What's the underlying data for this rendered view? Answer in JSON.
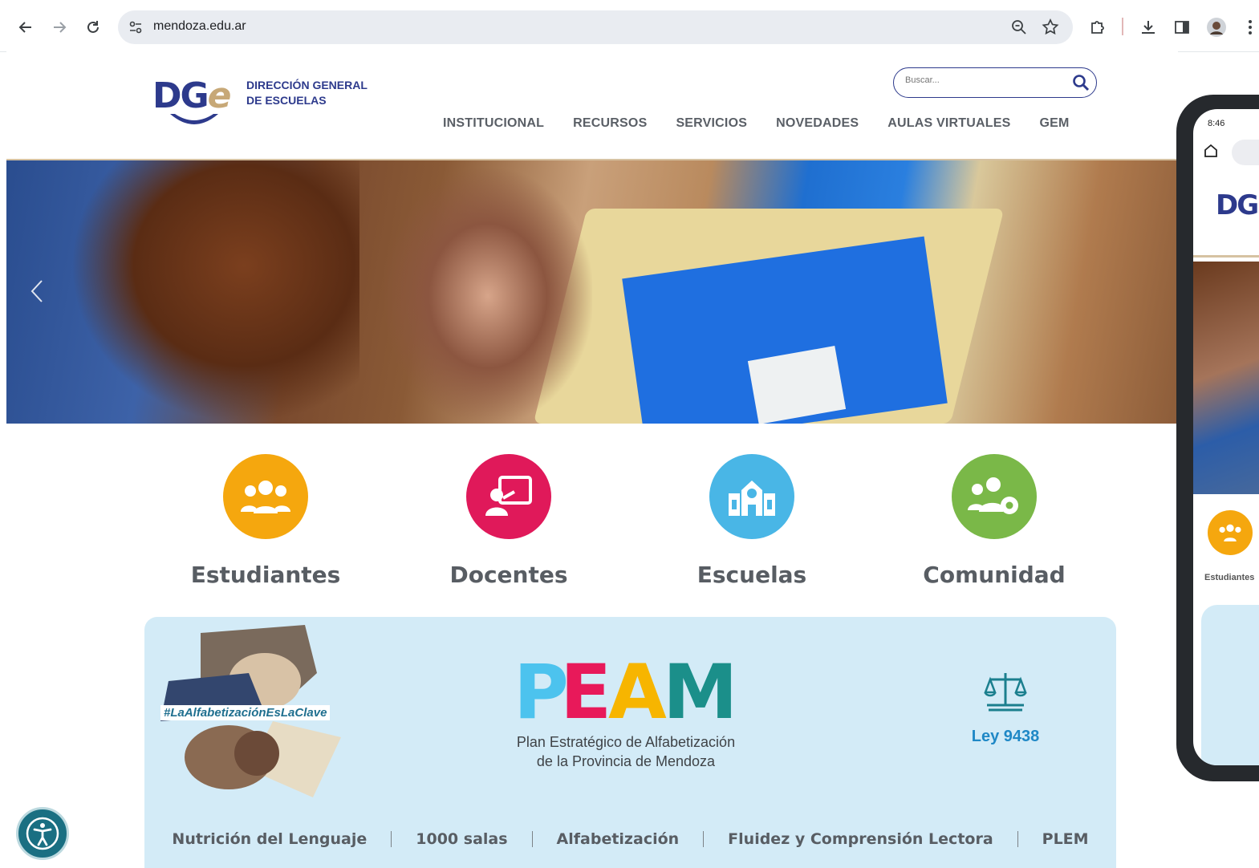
{
  "browser": {
    "url": "mendoza.edu.ar"
  },
  "header": {
    "logo_dg": "DG",
    "logo_e": "e",
    "logo_line1": "DIRECCIÓN GENERAL",
    "logo_line2": "DE ESCUELAS",
    "search_placeholder": "Buscar...",
    "nav": [
      "INSTITUCIONAL",
      "RECURSOS",
      "SERVICIOS",
      "NOVEDADES",
      "AULAS VIRTUALES",
      "GEM"
    ]
  },
  "categories": [
    {
      "label": "Estudiantes",
      "color": "#f5a70e",
      "icon": "users-icon"
    },
    {
      "label": "Docentes",
      "color": "#e0195a",
      "icon": "teacher-board-icon"
    },
    {
      "label": "Escuelas",
      "color": "#49b6e6",
      "icon": "school-building-icon"
    },
    {
      "label": "Comunidad",
      "color": "#7ab848",
      "icon": "community-gear-icon"
    }
  ],
  "banner": {
    "hashtag": "#LaAlfabetizaciónEsLaClave",
    "peam_letters": [
      "P",
      "E",
      "A",
      "M"
    ],
    "peam_colors": [
      "#4cc3ee",
      "#e8195a",
      "#f7b500",
      "#1b8f8a"
    ],
    "subtitle_line1": "Plan Estratégico de Alfabetización",
    "subtitle_line2": "de la Provincia de Mendoza",
    "ley_label": "Ley 9438",
    "links": [
      "Nutrición del Lenguaje",
      "1000 salas",
      "Alfabetización",
      "Fluidez y Comprensión Lectora",
      "PLEM"
    ]
  },
  "phone": {
    "status_time": "8:46",
    "logo": "DG",
    "category_label": "Estudiantes"
  },
  "colors": {
    "brand_blue": "#2d3a8c",
    "brand_gold": "#c7a877",
    "banner_bg": "#d3ebf7",
    "a11y_teal": "#1a6f82"
  }
}
